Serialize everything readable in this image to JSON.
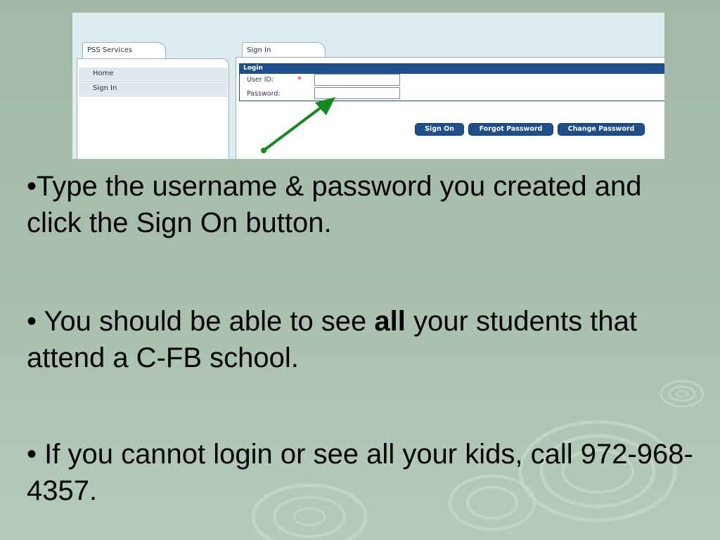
{
  "screenshot": {
    "tabs": {
      "services": "PSS Services",
      "sign_in": "Sign In"
    },
    "sidebar": {
      "items": [
        "Home",
        "Sign In"
      ]
    },
    "login": {
      "header": "Login",
      "user_id_label": "User ID:",
      "required_mark": "*",
      "password_label": "Password:",
      "user_id_value": "",
      "password_value": ""
    },
    "buttons": {
      "sign_on": "Sign On",
      "forgot_password": "Forgot Password",
      "change_password": "Change Password"
    },
    "colors": {
      "accent": "#1f4f8a",
      "arrow": "#138a1c",
      "required": "#d01818"
    }
  },
  "bullets": {
    "first": "•Type the username & password you created and click the Sign On button.",
    "second_before": "• You should be able to see ",
    "second_bold": "all",
    "second_after": " your students that attend a C-FB school.",
    "third": "• If you cannot login or see all your kids, call 972-968-4357."
  },
  "background": {
    "base_color": "#a9c0ae"
  }
}
